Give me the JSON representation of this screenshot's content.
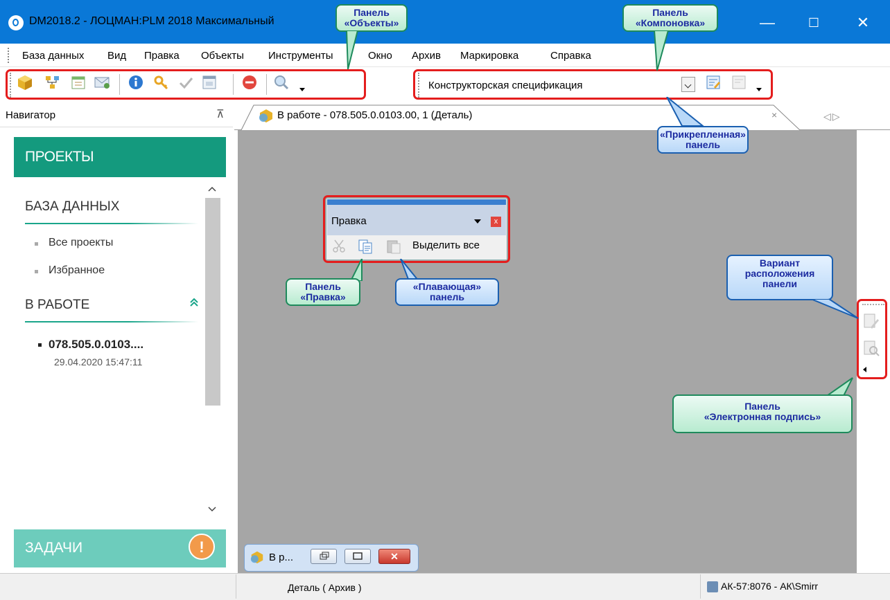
{
  "window": {
    "title": "DM2018.2 - ЛОЦМАН:PLM 2018 Максимальный",
    "minimize": "—",
    "maximize": "☐",
    "close": "✕"
  },
  "menu": [
    "База данных",
    "Вид",
    "Правка",
    "Объекты",
    "Инструменты",
    "Окно",
    "Архив",
    "Маркировка",
    "Справка"
  ],
  "layout_combo": {
    "value": "Конструкторская спецификация"
  },
  "navigator": {
    "title": "Навигатор",
    "pin": "⊼",
    "projects": "ПРОЕКТЫ",
    "database_heading": "БАЗА ДАННЫХ",
    "links": [
      "Все проекты",
      "Избранное"
    ],
    "in_work_heading": "В РАБОТЕ",
    "collapse": "≈",
    "work_item": "078.505.0.0103....",
    "work_date": "29.04.2020 15:47:11",
    "scroll_up": "^",
    "scroll_down": "v",
    "tasks": "ЗАДАЧИ",
    "alert": "!"
  },
  "document_tab": {
    "label": "В работе - 078.505.0.0103.00, 1 (Деталь)",
    "close": "×",
    "nav": "◁▷"
  },
  "floating_panel": {
    "title": "Правка",
    "close": "x",
    "select_all": "Выделить все"
  },
  "minimized_window": {
    "label": "В р...",
    "close": "✕"
  },
  "statusbar": {
    "left": "Деталь ( Архив )",
    "right": "АК-57:8076 - АК\\Smirr"
  },
  "callouts": {
    "objects": [
      "Панель",
      "«Объекты»"
    ],
    "layout": [
      "Панель",
      "«Компоновка»"
    ],
    "docked": [
      "«Прикрепленная»",
      "панель"
    ],
    "edit": [
      "Панель",
      "«Правка»"
    ],
    "floating": [
      "«Плавающая»",
      "панель"
    ],
    "placement": [
      "Вариант",
      "расположения",
      "панели"
    ],
    "esign": [
      "Панель",
      "«Электронная подпись»"
    ]
  },
  "colors": {
    "titlebar": "#0a78d7",
    "projects_banner": "#149a7e",
    "tasks_banner": "#6dccbc",
    "highlight": "#e41d1d",
    "workspace": "#a6a6a6"
  }
}
